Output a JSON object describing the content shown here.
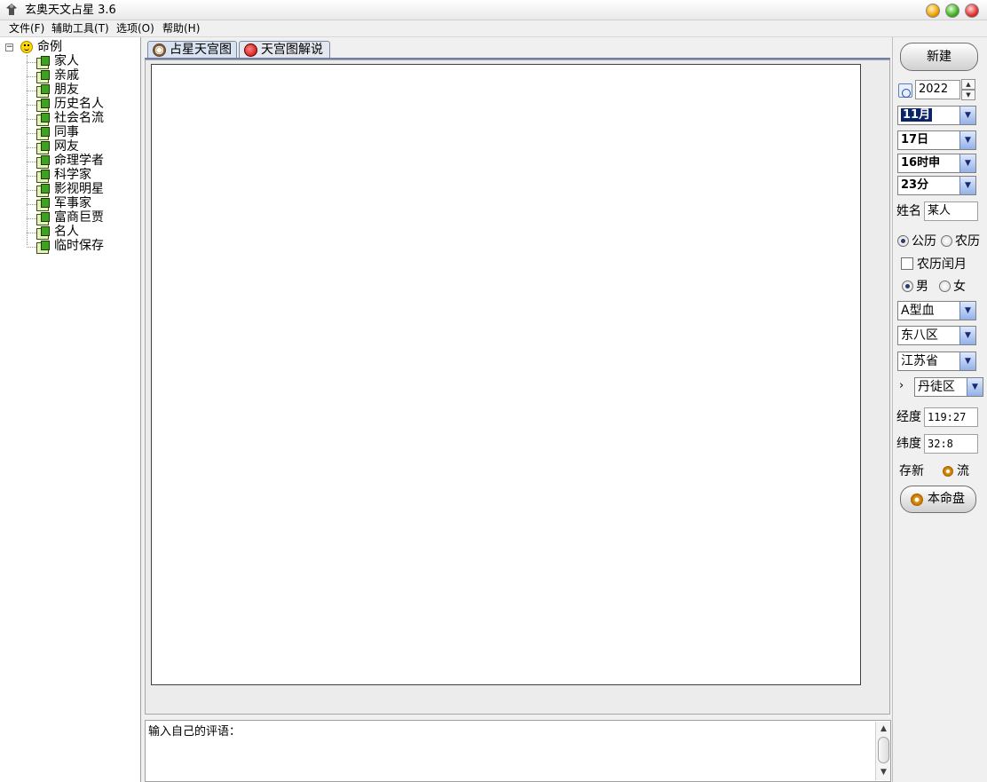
{
  "window": {
    "title": "玄奥天文占星 3.6"
  },
  "menu": [
    "文件(F)",
    "辅助工具(T)",
    "选项(O)",
    "帮助(H)"
  ],
  "tree": {
    "root_label": "命例",
    "children": [
      "家人",
      "亲戚",
      "朋友",
      "历史名人",
      "社会名流",
      "同事",
      "网友",
      "命理学者",
      "科学家",
      "影视明星",
      "军事家",
      "富商巨贾",
      "名人",
      "临时保存"
    ]
  },
  "tabs": [
    "占星天宫图",
    "天宫图解说"
  ],
  "comment": {
    "text": "输入自己的评语："
  },
  "form": {
    "new_button": "新建",
    "year": "2022",
    "month": "11月",
    "day": "17日",
    "hour": "16时申",
    "minute": "23分",
    "name_label": "姓名",
    "name_value": "某人",
    "calendar_solar": "公历",
    "calendar_lunar": "农历",
    "leap_month": "农历闰月",
    "gender_male": "男",
    "gender_female": "女",
    "blood_type": "A型血",
    "timezone": "东八区",
    "province": "江苏省",
    "district": "丹徒区",
    "longitude_label": "经度",
    "longitude_value": "119:27",
    "latitude_label": "纬度",
    "latitude_value": "32:8",
    "save_new": "存新",
    "flow": "流",
    "natal_chart_button": "本命盘"
  }
}
